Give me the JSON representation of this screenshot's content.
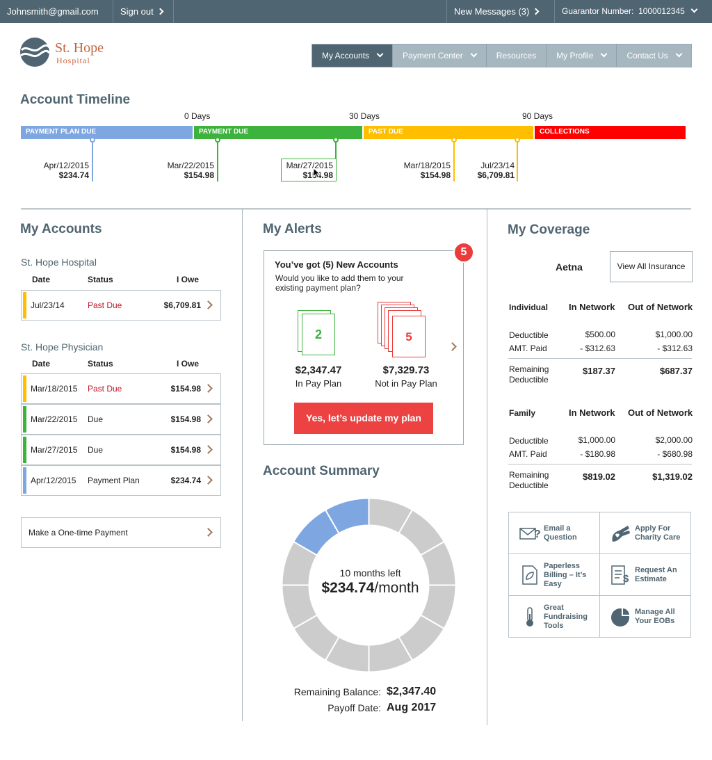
{
  "topbar": {
    "email": "Johnsmith@gmail.com",
    "sign_out": "Sign out",
    "messages": "New Messages (3)",
    "guarantor_label": "Guarantor Number:",
    "guarantor_number": "1000012345"
  },
  "logo": {
    "name": "St. Hope",
    "sub": "Hospital"
  },
  "nav": [
    "My Accounts",
    "Payment Center",
    "Resources",
    "My Profile",
    "Contact Us"
  ],
  "timeline": {
    "title": "Account Timeline",
    "day_marks": [
      "0 Days",
      "30 Days",
      "90 Days"
    ],
    "bars": [
      "PAYMENT PLAN DUE",
      "PAYMENT DUE",
      "PAST DUE",
      "COLLECTIONS"
    ],
    "events": [
      {
        "date": "Apr/12/2015",
        "amount": "$234.74"
      },
      {
        "date": "Mar/22/2015",
        "amount": "$154.98"
      },
      {
        "date": "Mar/27/2015",
        "amount": "$154.98"
      },
      {
        "date": "Mar/18/2015",
        "amount": "$154.98"
      },
      {
        "date": "Jul/23/14",
        "amount": "$6,709.81"
      }
    ],
    "colors": {
      "plan": "#7ea6e0",
      "due": "#3db23d",
      "past": "#ffbe00",
      "collections": "#ff0000"
    }
  },
  "my_accounts": {
    "title": "My Accounts",
    "headers": [
      "Date",
      "Status",
      "I Owe"
    ],
    "groups": [
      {
        "name": "St. Hope Hospital",
        "rows": [
          {
            "date": "Jul/23/14",
            "status": "Past Due",
            "amount": "$6,709.81"
          }
        ]
      },
      {
        "name": "St. Hope Physician",
        "rows": [
          {
            "date": "Mar/18/2015",
            "status": "Past Due",
            "amount": "$154.98"
          },
          {
            "date": "Mar/22/2015",
            "status": "Due",
            "amount": "$154.98"
          },
          {
            "date": "Mar/27/2015",
            "status": "Due",
            "amount": "$154.98"
          },
          {
            "date": "Apr/12/2015",
            "status": "Payment Plan",
            "amount": "$234.74"
          }
        ]
      }
    ],
    "one_time_payment": "Make a One-time Payment"
  },
  "alerts": {
    "title": "My Alerts",
    "badge": "5",
    "heading": "You’ve got (5) New Accounts",
    "body": "Would you like to add them to your existing payment plan?",
    "in_plan_count": "2",
    "in_plan_amount": "$2,347.47",
    "in_plan_label": "In Pay Plan",
    "not_plan_count": "5",
    "not_plan_amount": "$7,329.73",
    "not_plan_label": "Not in Pay Plan",
    "cta": "Yes, let’s update my plan"
  },
  "summary": {
    "title": "Account Summary",
    "months_left": "10 months left",
    "per_month_amount": "$234.74",
    "per_month_unit": "/month",
    "remaining_label": "Remaining Balance:",
    "remaining_value": "$2,347.40",
    "payoff_label": "Payoff Date:",
    "payoff_value": "Aug 2017",
    "segments_total": 12,
    "segments_paid": 2
  },
  "coverage": {
    "title": "My Coverage",
    "insurer": "Aetna",
    "view_all": "View All Insurance",
    "individual": {
      "label": "Individual",
      "in": "In Network",
      "out": "Out of Network",
      "deductible_label": "Deductible",
      "deductible_in": "$500.00",
      "deductible_out": "$1,000.00",
      "paid_label": "AMT. Paid",
      "paid_in": "- $312.63",
      "paid_out": "- $312.63",
      "remaining_label": "Remaining Deductible",
      "remaining_in": "$187.37",
      "remaining_out": "$687.37"
    },
    "family": {
      "label": "Family",
      "in": "In Network",
      "out": "Out of Network",
      "deductible_label": "Deductible",
      "deductible_in": "$1,000.00",
      "deductible_out": "$2,000.00",
      "paid_label": "AMT. Paid",
      "paid_in": "- $180.98",
      "paid_out": "- $680.98",
      "remaining_label": "Remaining Deductible",
      "remaining_in": "$819.02",
      "remaining_out": "$1,319.02"
    },
    "tiles": [
      {
        "label": "Email a Question",
        "icon": "envelope-question-icon"
      },
      {
        "label": "Apply For Charity Care",
        "icon": "heart-hand-icon"
      },
      {
        "label": "Paperless Billing – It’s Easy",
        "icon": "leaf-document-icon"
      },
      {
        "label": "Request An Estimate",
        "icon": "estimate-list-icon"
      },
      {
        "label": "Great Fundraising Tools",
        "icon": "thermometer-icon"
      },
      {
        "label": "Manage All Your EOBs",
        "icon": "pie-chart-icon"
      }
    ]
  }
}
